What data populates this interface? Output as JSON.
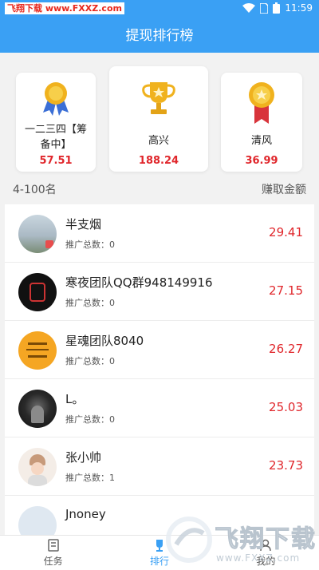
{
  "status": {
    "watermark": "飞翔下载 www.FXXZ.com",
    "time": "11:59"
  },
  "header": {
    "title": "提现排行榜"
  },
  "top3": [
    {
      "name": "一二三四【筹备中】",
      "amount": "57.51",
      "icon": "silver-medal-icon"
    },
    {
      "name": "高兴",
      "amount": "188.24",
      "icon": "gold-trophy-icon"
    },
    {
      "name": "清风",
      "amount": "36.99",
      "icon": "bronze-medal-icon"
    }
  ],
  "section": {
    "left": "4-100名",
    "right": "赚取金额"
  },
  "list": [
    {
      "name": "半支烟",
      "count": "推广总数：0",
      "amount": "29.41"
    },
    {
      "name": "寒夜团队QQ群948149916",
      "count": "推广总数：0",
      "amount": "27.15"
    },
    {
      "name": "星魂团队8040",
      "count": "推广总数：0",
      "amount": "26.27"
    },
    {
      "name": "L。",
      "count": "推广总数：0",
      "amount": "25.03"
    },
    {
      "name": "张小帅",
      "count": "推广总数：1",
      "amount": "23.73"
    },
    {
      "name": "Jnoney",
      "count": "",
      "amount": ""
    }
  ],
  "tabs": [
    {
      "label": "任务"
    },
    {
      "label": "排行"
    },
    {
      "label": "我的"
    }
  ],
  "watermark_bottom": {
    "text": "飞翔下载",
    "url": "www.FXXZ.com"
  },
  "colors": {
    "header": "#3aa0f4",
    "amount": "#e0262b"
  }
}
